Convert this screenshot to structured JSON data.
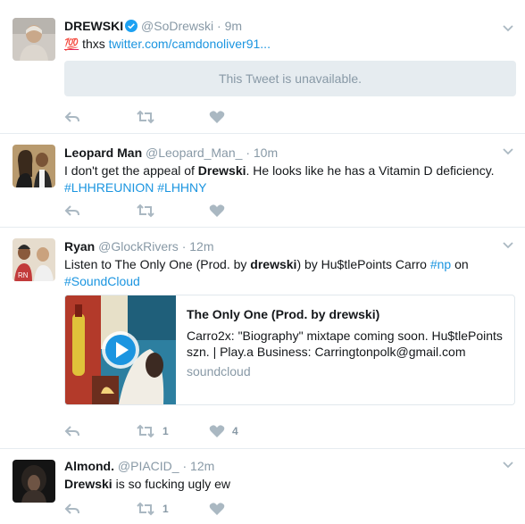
{
  "colors": {
    "accent": "#1b95e0",
    "muted": "#8899a6",
    "icon": "#aab8c2",
    "verified": "#1da1f2",
    "divider": "#e6ecf0"
  },
  "tweets": [
    {
      "fullname": "DREWSKI",
      "verified": true,
      "handle": "@SoDrewski",
      "dot": "·",
      "time": "9m",
      "emoji": "💯",
      "text_prefix": "thxs",
      "link": "twitter.com/camdonoliver91...",
      "quoted_unavailable": "This Tweet is unavailable.",
      "actions": {
        "reply_icon": "reply-icon",
        "retweet_icon": "retweet-icon",
        "like_icon": "heart-icon",
        "retweets": "",
        "likes": ""
      }
    },
    {
      "fullname": "Leopard Man",
      "handle": "@Leopard_Man_",
      "dot": "·",
      "time": "10m",
      "text_a": "I don't get the appeal of",
      "text_strong": "Drewski",
      "text_b": ". He looks like he has a Vitamin D deficiency.",
      "hashtag1": "#LHHREUNION",
      "hashtag2": "#LHHNY",
      "actions": {
        "retweets": "",
        "likes": ""
      }
    },
    {
      "fullname": "Ryan",
      "handle": "@GlockRivers",
      "dot": "·",
      "time": "12m",
      "text_a": "Listen to The Only One (Prod. by",
      "text_strong": "drewski",
      "text_b": ") by Hu$tlePoints Carro",
      "hashtag1": "#np",
      "text_c": "on",
      "hashtag2": "#SoundCloud",
      "card": {
        "title": "The Only One (Prod. by drewski)",
        "description": "Carro2x: \"Biography\" mixtape coming soon. Hu$tlePoints szn. | Play.a Business: Carringtonpolk@gmail.com",
        "domain": "soundcloud"
      },
      "actions": {
        "retweets": "1",
        "likes": "4"
      }
    },
    {
      "fullname": "Almond.",
      "handle": "@PIACID_",
      "dot": "·",
      "time": "12m",
      "text_strong": "Drewski",
      "text_b": "is so fucking ugly ew",
      "actions": {
        "retweets": "1",
        "likes": ""
      }
    }
  ]
}
